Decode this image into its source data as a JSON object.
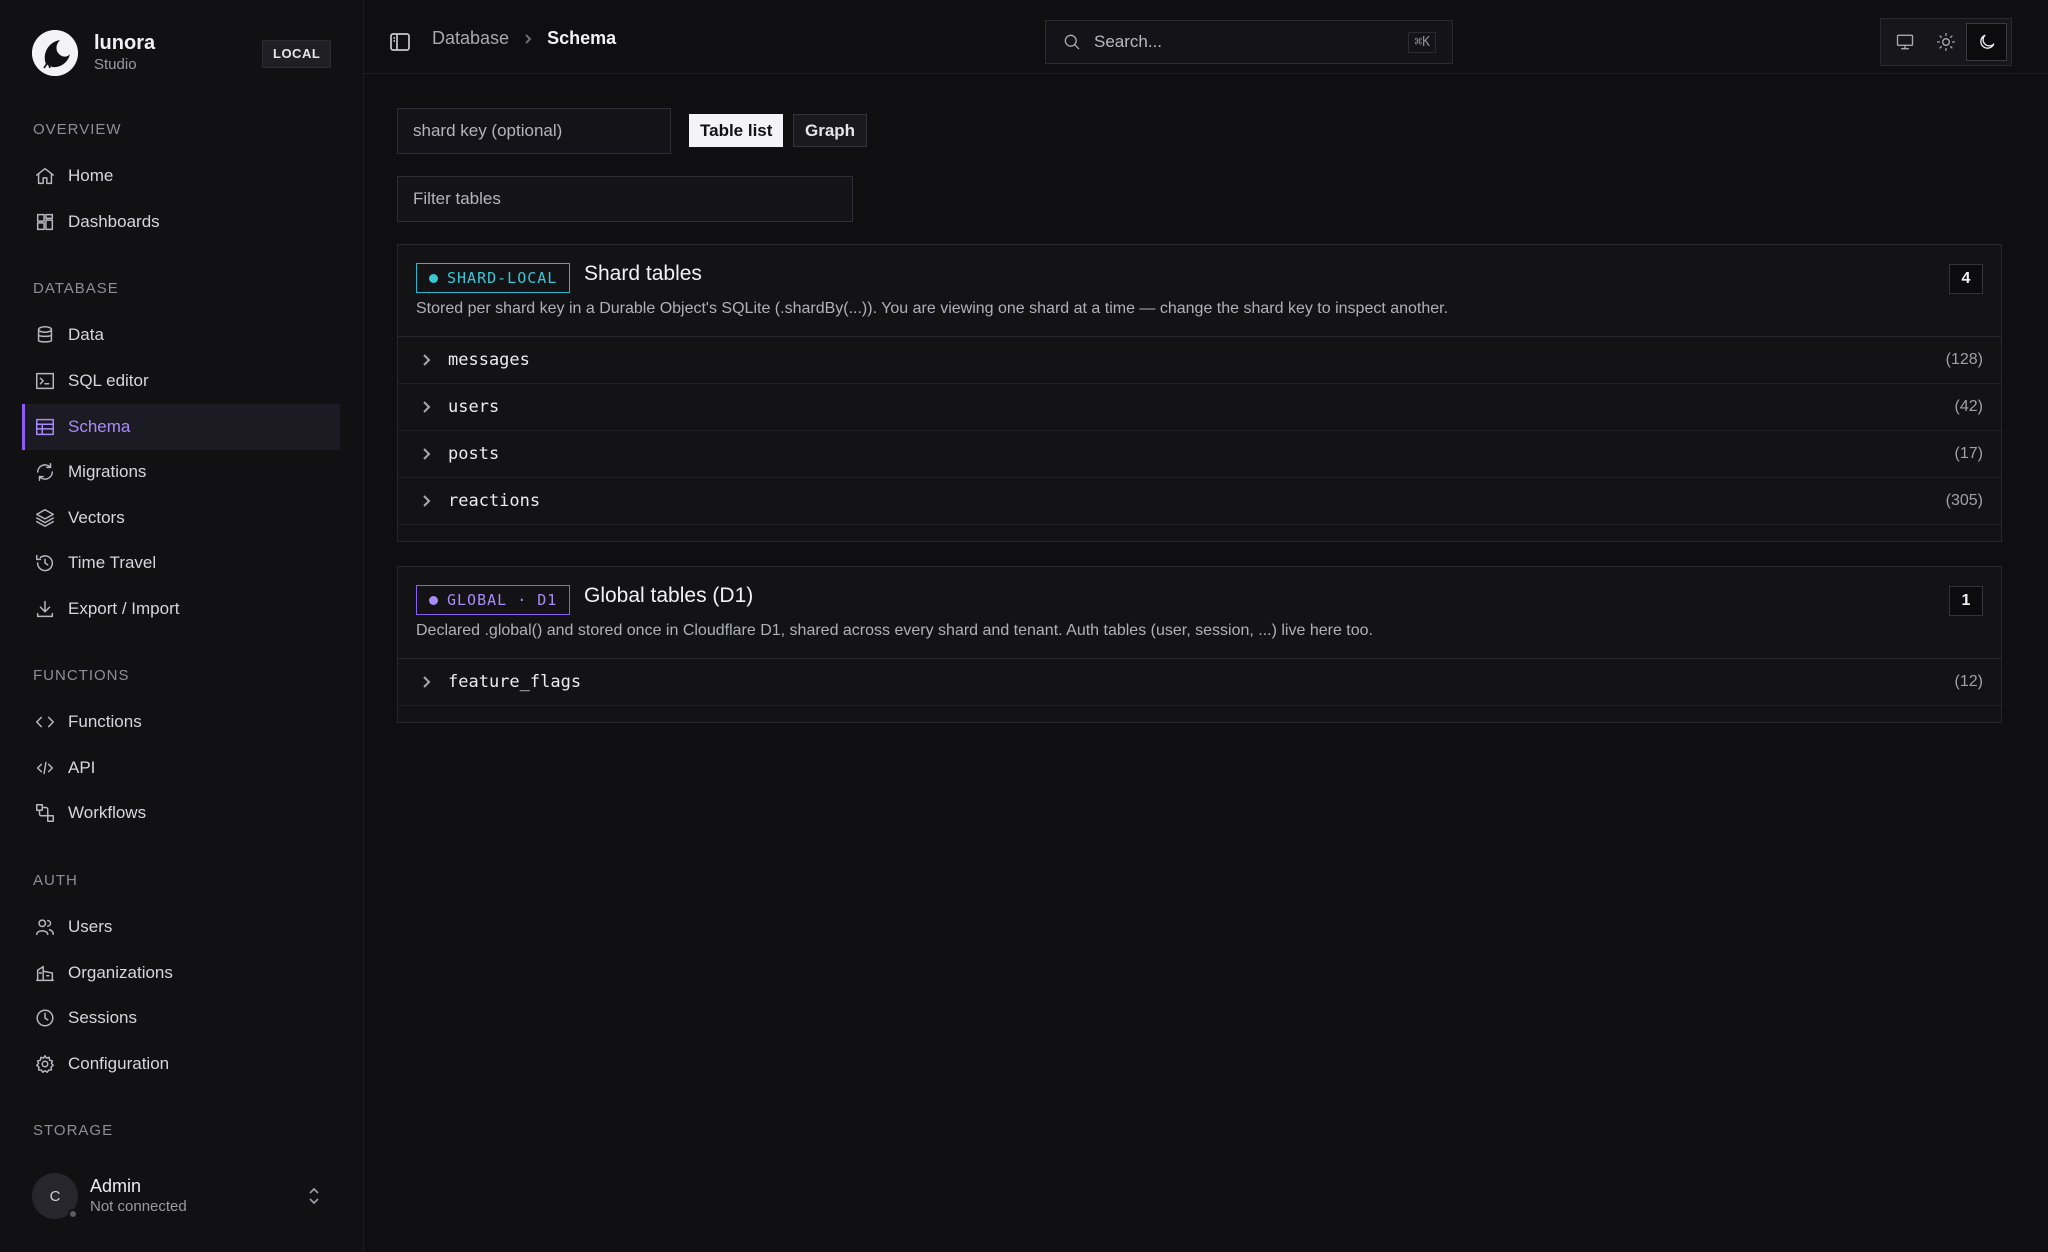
{
  "brand": {
    "name": "lunora",
    "subtitle": "Studio",
    "env_badge": "LOCAL"
  },
  "sidebar": {
    "sections": [
      {
        "title": "OVERVIEW",
        "items": [
          {
            "label": "Home",
            "icon": "home-icon"
          },
          {
            "label": "Dashboards",
            "icon": "dashboard-icon"
          }
        ]
      },
      {
        "title": "DATABASE",
        "items": [
          {
            "label": "Data",
            "icon": "database-icon"
          },
          {
            "label": "SQL editor",
            "icon": "terminal-icon"
          },
          {
            "label": "Schema",
            "icon": "table-icon",
            "active": true
          },
          {
            "label": "Migrations",
            "icon": "refresh-icon"
          },
          {
            "label": "Vectors",
            "icon": "layers-icon"
          },
          {
            "label": "Time Travel",
            "icon": "history-icon"
          },
          {
            "label": "Export / Import",
            "icon": "download-icon"
          }
        ]
      },
      {
        "title": "FUNCTIONS",
        "items": [
          {
            "label": "Functions",
            "icon": "code-icon"
          },
          {
            "label": "API",
            "icon": "api-icon"
          },
          {
            "label": "Workflows",
            "icon": "workflow-icon"
          }
        ]
      },
      {
        "title": "AUTH",
        "items": [
          {
            "label": "Users",
            "icon": "users-icon"
          },
          {
            "label": "Organizations",
            "icon": "building-icon"
          },
          {
            "label": "Sessions",
            "icon": "clock-icon"
          },
          {
            "label": "Configuration",
            "icon": "gear-icon"
          }
        ]
      },
      {
        "title": "STORAGE",
        "items": []
      }
    ],
    "user": {
      "initial": "C",
      "name": "Admin",
      "status": "Not connected"
    }
  },
  "topbar": {
    "breadcrumb": [
      "Database",
      "Schema"
    ],
    "search_placeholder": "Search...",
    "search_shortcut": "⌘K",
    "theme_options": [
      "monitor-icon",
      "sun-icon",
      "moon-icon"
    ],
    "theme_active": "moon-icon"
  },
  "main": {
    "shard_key_placeholder": "shard key (optional)",
    "view_toggle": {
      "table_list": "Table list",
      "graph": "Graph",
      "active": "table_list"
    },
    "filter_placeholder": "Filter tables",
    "groups": [
      {
        "tag": "SHARD-LOCAL",
        "tag_color": "#38c6d8",
        "title": "Shard tables",
        "description": "Stored per shard key in a Durable Object's SQLite (.shardBy(...)). You are viewing one shard at a time — change the shard key to inspect another.",
        "count": "4",
        "tables": [
          {
            "name": "messages",
            "rows": "(128)"
          },
          {
            "name": "users",
            "rows": "(42)"
          },
          {
            "name": "posts",
            "rows": "(17)"
          },
          {
            "name": "reactions",
            "rows": "(305)"
          }
        ]
      },
      {
        "tag": "GLOBAL · D1",
        "tag_color": "#a78bfa",
        "title": "Global tables (D1)",
        "description": "Declared .global() and stored once in Cloudflare D1, shared across every shard and tenant. Auth tables (user, session, ...) live here too.",
        "count": "1",
        "tables": [
          {
            "name": "feature_flags",
            "rows": "(12)"
          }
        ]
      }
    ]
  }
}
